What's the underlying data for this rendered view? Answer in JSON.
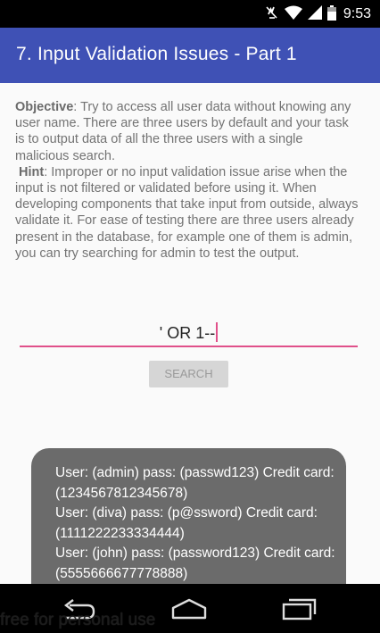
{
  "status_bar": {
    "time": "9:53",
    "icons": [
      "mute-icon",
      "wifi-icon",
      "signal-icon",
      "battery-icon"
    ]
  },
  "app_bar": {
    "title": "7. Input Validation Issues - Part 1",
    "color": "#3f51b5"
  },
  "description": {
    "objective_label": "Objective",
    "objective_text": ": Try to access all user data without knowing any user name. There are three users by default and your task is to output data of all the three users with a single malicious search.",
    "hint_label": "Hint",
    "hint_text": ": Improper or no input validation issue arise when the input is not filtered or validated before using it. When developing components that take input from outside, always validate it. For ease of testing there are three users already present in the database, for example one of them is admin, you can try searching for admin to test the output."
  },
  "search": {
    "value": "' OR 1--",
    "button_label": "SEARCH",
    "accent": "#e0508a"
  },
  "toast": {
    "lines": [
      "User: (admin) pass: (passwd123) Credit card:",
      "(1234567812345678)",
      "User: (diva) pass: (p@ssword) Credit card:",
      "(1111222233334444)",
      "User: (john) pass: (password123) Credit card:",
      "(5555666677778888)"
    ]
  },
  "nav_bar": {
    "icons": [
      "back-icon",
      "home-icon",
      "recents-icon"
    ]
  },
  "watermark": "free for personal use"
}
